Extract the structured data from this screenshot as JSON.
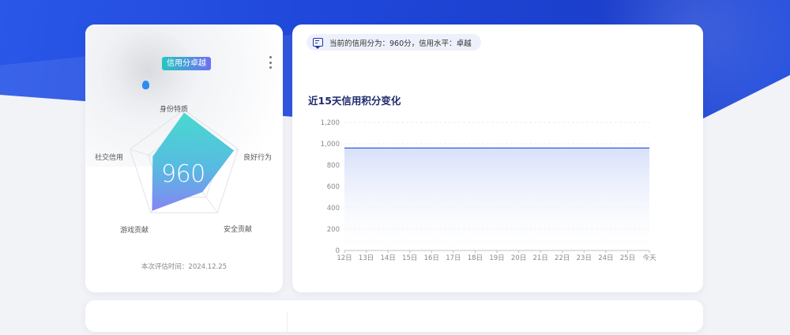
{
  "credit_card": {
    "badge": "信用分卓越",
    "score": "960",
    "radar_labels": [
      "身份特质",
      "良好行为",
      "安全贡献",
      "游戏贡献",
      "社交信用"
    ],
    "radar_values": [
      0.95,
      0.92,
      0.55,
      0.96,
      0.58
    ],
    "eval_time": "本次评估时间：2024.12.25"
  },
  "tip": {
    "text": "当前的信用分为：960分，信用水平：卓越"
  },
  "chart_section": {
    "title": "近15天信用积分变化"
  },
  "chart_data": {
    "type": "area",
    "categories": [
      "12日",
      "13日",
      "14日",
      "15日",
      "16日",
      "17日",
      "18日",
      "19日",
      "20日",
      "21日",
      "22日",
      "23日",
      "24日",
      "25日",
      "今天"
    ],
    "values": [
      960,
      960,
      960,
      960,
      960,
      960,
      960,
      960,
      960,
      960,
      960,
      960,
      960,
      960,
      960
    ],
    "yticks": [
      "0",
      "200",
      "400",
      "600",
      "800",
      "1,000",
      "1,200"
    ],
    "ylim": [
      0,
      1200
    ],
    "xlabel": "",
    "ylabel": "",
    "grid": "horizontal",
    "line_color": "#3b5bdb",
    "fill_color": "#dbe3fb"
  },
  "colors": {
    "banner": "#1e46d8",
    "radar_fill_start": "#4ad6c9",
    "radar_fill_end": "#7b7ff0",
    "title": "#1f2b6a"
  }
}
